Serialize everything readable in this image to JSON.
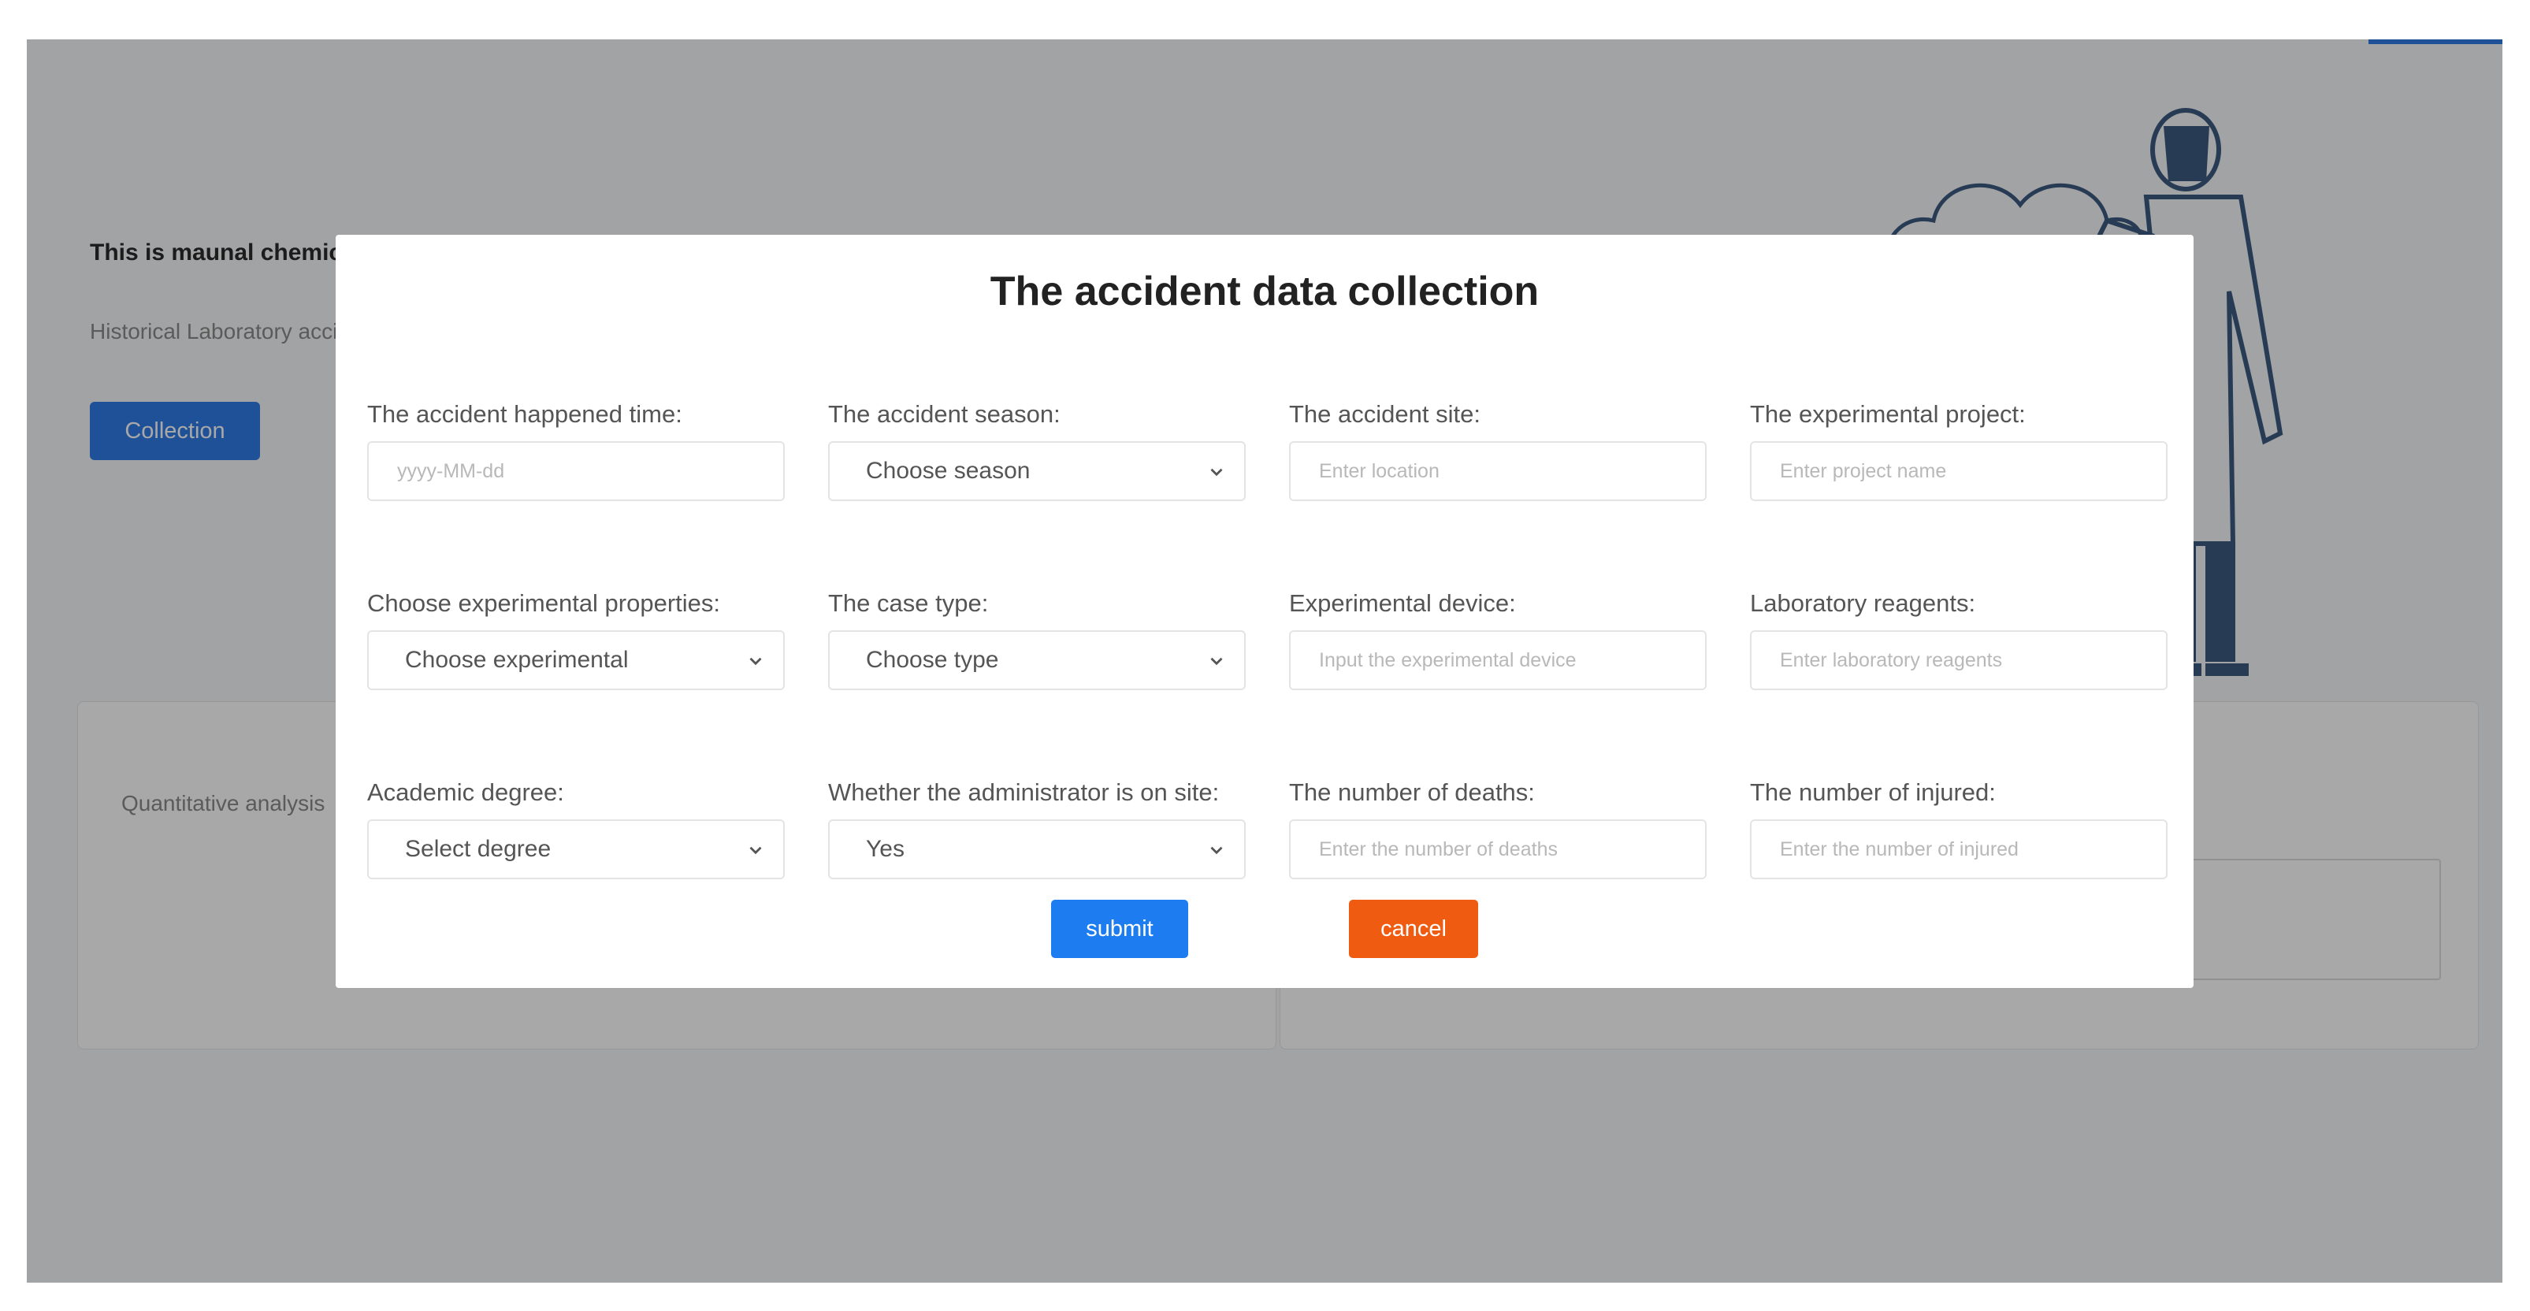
{
  "background": {
    "title": "This is maunal chemical accident risk prediction",
    "subtitle": "Historical Laboratory accident",
    "collection_button": "Collection",
    "card_text": "Quantitative analysis"
  },
  "modal": {
    "title": "The accident data collection",
    "fields": [
      {
        "label": "The accident happened time:",
        "type": "input",
        "value": "yyyy-MM-dd"
      },
      {
        "label": "The accident season:",
        "type": "select",
        "value": "Choose season"
      },
      {
        "label": "The accident site:",
        "type": "input",
        "value": "Enter location"
      },
      {
        "label": "The experimental project:",
        "type": "input",
        "value": "Enter project name"
      },
      {
        "label": "Choose experimental properties:",
        "type": "select",
        "value": "Choose experimental"
      },
      {
        "label": "The case type:",
        "type": "select",
        "value": "Choose type"
      },
      {
        "label": "Experimental device:",
        "type": "input",
        "value": "Input the experimental device"
      },
      {
        "label": "Laboratory reagents:",
        "type": "input",
        "value": "Enter laboratory reagents"
      },
      {
        "label": "Academic degree:",
        "type": "select",
        "value": "Select degree"
      },
      {
        "label": "Whether the administrator is on site:",
        "type": "select",
        "value": "Yes"
      },
      {
        "label": "The number of deaths:",
        "type": "input",
        "value": "Enter the number of deaths"
      },
      {
        "label": "The number of injured:",
        "type": "input",
        "value": "Enter the number of injured"
      }
    ],
    "submit_label": "submit",
    "cancel_label": "cancel"
  },
  "colors": {
    "primary": "#1c7cf0",
    "danger": "#f05b12",
    "overlay": "rgba(0,0,0,0.34)"
  },
  "icons": [
    "chevron-down-icon",
    "scientist-illustration"
  ]
}
